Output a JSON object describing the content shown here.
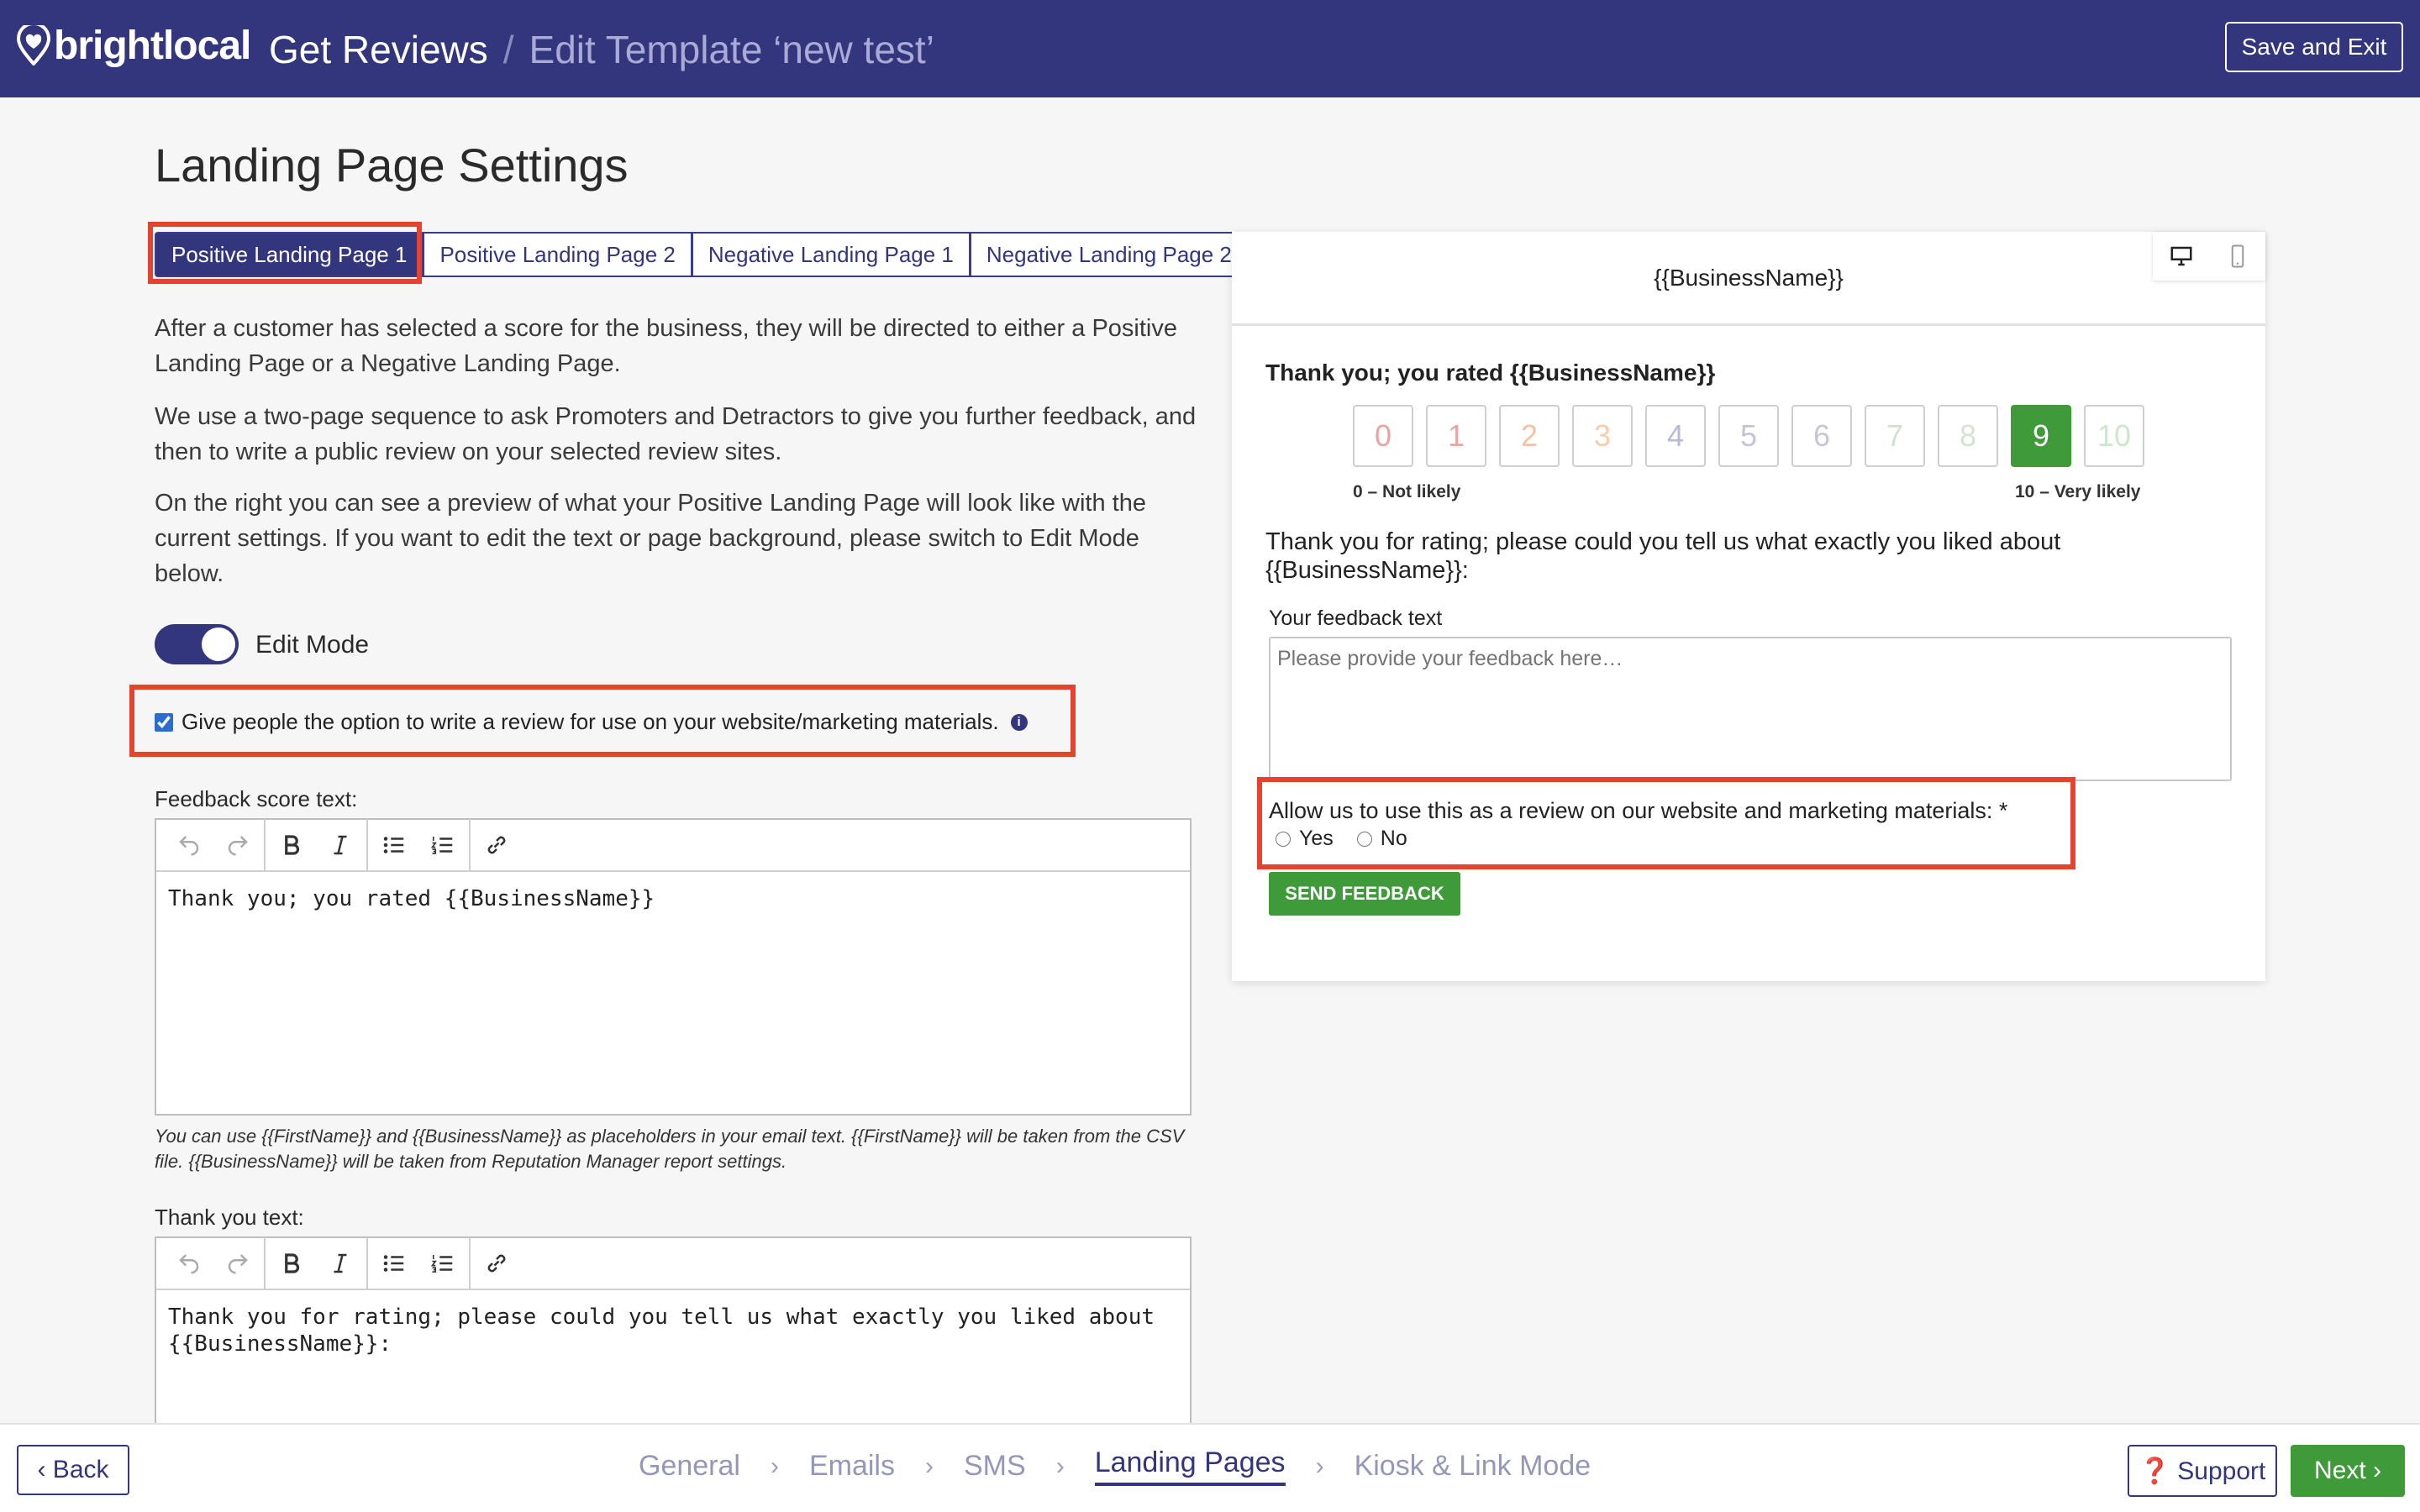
{
  "header": {
    "logo_text": "brightlocal",
    "breadcrumb_main": "Get Reviews",
    "breadcrumb_sep": "/",
    "breadcrumb_sub": "Edit Template ‘new test’",
    "save_exit_label": "Save and Exit"
  },
  "main": {
    "title": "Landing Page Settings",
    "tabs": [
      {
        "label": "Positive Landing Page 1",
        "active": true
      },
      {
        "label": "Positive Landing Page 2",
        "active": false
      },
      {
        "label": "Negative Landing Page 1",
        "active": false
      },
      {
        "label": "Negative Landing Page 2",
        "active": false
      }
    ],
    "paragraphs": [
      "After a customer has selected a score for the business, they will be directed to either a Positive Landing Page or a Negative Landing Page.",
      "We use a two-page sequence to ask Promoters and Detractors to give you further feedback, and then to write a public review on your selected review sites.",
      "On the right you can see a preview of what your Positive Landing Page will look like with the current settings. If you want to edit the text or page background, please switch to Edit Mode below."
    ],
    "edit_mode_label": "Edit Mode",
    "edit_mode_on": true,
    "review_option_label": "Give people the option to write a review for use on your website/marketing materials.",
    "review_option_checked": true,
    "info_glyph": "i",
    "feedback_score_label": "Feedback score text:",
    "feedback_score_value": "Thank you; you rated {{BusinessName}}",
    "placeholder_hint": "You can use {{FirstName}} and {{BusinessName}} as placeholders in your email text. {{FirstName}} will be taken from the CSV file. {{BusinessName}} will be taken from Reputation Manager report settings.",
    "thank_you_label": "Thank you text:",
    "thank_you_value_line1": "Thank you for rating; please could you tell us what exactly you liked about",
    "thank_you_value_line2": "{{BusinessName}}:"
  },
  "toolbar": {
    "icons": [
      "undo-icon",
      "redo-icon",
      "bold-icon",
      "italic-icon",
      "bullet-list-icon",
      "numbered-list-icon",
      "link-icon"
    ]
  },
  "preview": {
    "business_name": "{{BusinessName}}",
    "title": "Thank you; you rated {{BusinessName}}",
    "scores": [
      {
        "label": "0",
        "color": "#e8a4a4"
      },
      {
        "label": "1",
        "color": "#eba3a3"
      },
      {
        "label": "2",
        "color": "#f2c4a4"
      },
      {
        "label": "3",
        "color": "#f5cda8"
      },
      {
        "label": "4",
        "color": "#b9bad6"
      },
      {
        "label": "5",
        "color": "#c3c4da"
      },
      {
        "label": "6",
        "color": "#c6c7d6"
      },
      {
        "label": "7",
        "color": "#cfe1d0"
      },
      {
        "label": "8",
        "color": "#d4e3d4"
      },
      {
        "label": "9",
        "color": "#3f9a3a",
        "selected": true
      },
      {
        "label": "10",
        "color": "#cde6cd"
      }
    ],
    "low_label": "0 – Not likely",
    "high_label": "10 – Very likely",
    "question": "Thank you for rating; please could you tell us what exactly you liked about {{BusinessName}}:",
    "feedback_label": "Your feedback text",
    "feedback_placeholder": "Please provide your feedback here…",
    "allow_label": "Allow us to use this as a review on our website and marketing materials: *",
    "yes_label": "Yes",
    "no_label": "No",
    "send_label": "SEND FEEDBACK"
  },
  "footer": {
    "back_label": "‹ Back",
    "steps": [
      {
        "label": "General",
        "active": false
      },
      {
        "label": "Emails",
        "active": false
      },
      {
        "label": "SMS",
        "active": false
      },
      {
        "label": "Landing Pages",
        "active": true
      },
      {
        "label": "Kiosk & Link Mode",
        "active": false
      }
    ],
    "chevron": "›",
    "support_label": "❓ Support",
    "next_label": "Next ›"
  },
  "colors": {
    "brand": "#33357d",
    "accent_green": "#3f9a3a",
    "highlight_red": "#e4432f"
  }
}
